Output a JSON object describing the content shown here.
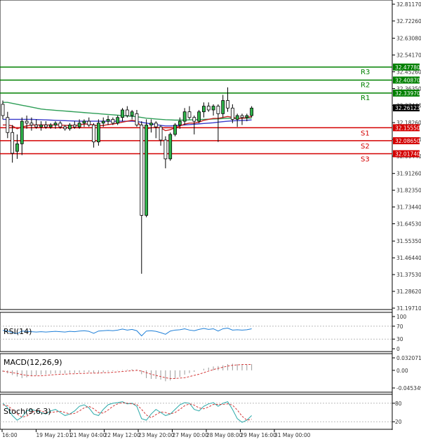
{
  "chart_data": [
    {
      "type": "candlestick",
      "title": "",
      "x_tick_labels": [
        "16:00",
        "19 May 21:01",
        "21 May 04:00",
        "22 May 12:00",
        "23 May 20:00",
        "27 May 00:00",
        "28 May 08:00",
        "29 May 16:00",
        "31 May 00:00"
      ],
      "y_tick_labels": [
        "32.81170",
        "32.72260",
        "32.63080",
        "32.54170",
        "32.45260",
        "32.36350",
        "32.27440",
        "32.18260",
        "32.09350",
        "32.00440",
        "31.91260",
        "31.82350",
        "31.73440",
        "31.64530",
        "31.55350",
        "31.46440",
        "31.37530",
        "31.28620",
        "31.19710"
      ],
      "ylim": [
        31.1971,
        32.8117
      ],
      "current_price": "32.26123",
      "levels": [
        {
          "name": "R3",
          "value": "32.47780",
          "color": "#008000"
        },
        {
          "name": "R2",
          "value": "32.40870",
          "color": "#008000"
        },
        {
          "name": "R1",
          "value": "32.33970",
          "color": "#008000"
        },
        {
          "name": "S1",
          "value": "32.15550",
          "color": "#d40000"
        },
        {
          "name": "S2",
          "value": "32.08650",
          "color": "#d40000"
        },
        {
          "name": "S3",
          "value": "32.01740",
          "color": "#d40000"
        }
      ],
      "candles": [
        {
          "o": 32.28,
          "h": 32.3,
          "l": 32.2,
          "c": 32.22
        },
        {
          "o": 32.21,
          "h": 32.24,
          "l": 32.1,
          "c": 32.13
        },
        {
          "o": 32.13,
          "h": 32.17,
          "l": 31.97,
          "c": 32.02
        },
        {
          "o": 32.03,
          "h": 32.12,
          "l": 31.99,
          "c": 32.07
        },
        {
          "o": 32.07,
          "h": 32.21,
          "l": 32.01,
          "c": 32.19
        },
        {
          "o": 32.19,
          "h": 32.22,
          "l": 32.15,
          "c": 32.18
        },
        {
          "o": 32.18,
          "h": 32.21,
          "l": 32.14,
          "c": 32.17
        },
        {
          "o": 32.17,
          "h": 32.2,
          "l": 32.15,
          "c": 32.16
        },
        {
          "o": 32.16,
          "h": 32.19,
          "l": 32.14,
          "c": 32.17
        },
        {
          "o": 32.17,
          "h": 32.19,
          "l": 32.15,
          "c": 32.16
        },
        {
          "o": 32.16,
          "h": 32.18,
          "l": 32.15,
          "c": 32.17
        },
        {
          "o": 32.17,
          "h": 32.19,
          "l": 32.15,
          "c": 32.18
        },
        {
          "o": 32.18,
          "h": 32.19,
          "l": 32.15,
          "c": 32.16
        },
        {
          "o": 32.16,
          "h": 32.17,
          "l": 32.14,
          "c": 32.15
        },
        {
          "o": 32.15,
          "h": 32.18,
          "l": 32.14,
          "c": 32.17
        },
        {
          "o": 32.17,
          "h": 32.19,
          "l": 32.15,
          "c": 32.16
        },
        {
          "o": 32.16,
          "h": 32.2,
          "l": 32.15,
          "c": 32.18
        },
        {
          "o": 32.18,
          "h": 32.2,
          "l": 32.16,
          "c": 32.19
        },
        {
          "o": 32.19,
          "h": 32.21,
          "l": 32.16,
          "c": 32.17
        },
        {
          "o": 32.17,
          "h": 32.18,
          "l": 32.05,
          "c": 32.08
        },
        {
          "o": 32.08,
          "h": 32.2,
          "l": 32.06,
          "c": 32.18
        },
        {
          "o": 32.18,
          "h": 32.21,
          "l": 32.16,
          "c": 32.19
        },
        {
          "o": 32.19,
          "h": 32.22,
          "l": 32.17,
          "c": 32.2
        },
        {
          "o": 32.2,
          "h": 32.21,
          "l": 32.17,
          "c": 32.18
        },
        {
          "o": 32.18,
          "h": 32.22,
          "l": 32.17,
          "c": 32.21
        },
        {
          "o": 32.21,
          "h": 32.26,
          "l": 32.19,
          "c": 32.25
        },
        {
          "o": 32.25,
          "h": 32.27,
          "l": 32.21,
          "c": 32.22
        },
        {
          "o": 32.22,
          "h": 32.25,
          "l": 32.2,
          "c": 32.24
        },
        {
          "o": 32.23,
          "h": 32.25,
          "l": 32.16,
          "c": 32.17
        },
        {
          "o": 32.17,
          "h": 32.19,
          "l": 31.38,
          "c": 31.69
        },
        {
          "o": 31.69,
          "h": 32.2,
          "l": 31.68,
          "c": 32.17
        },
        {
          "o": 32.17,
          "h": 32.2,
          "l": 32.13,
          "c": 32.18
        },
        {
          "o": 32.18,
          "h": 32.19,
          "l": 32.1,
          "c": 32.16
        },
        {
          "o": 32.16,
          "h": 32.17,
          "l": 32.06,
          "c": 32.09
        },
        {
          "o": 32.09,
          "h": 32.11,
          "l": 31.94,
          "c": 31.99
        },
        {
          "o": 31.99,
          "h": 32.13,
          "l": 31.98,
          "c": 32.12
        },
        {
          "o": 32.12,
          "h": 32.18,
          "l": 32.11,
          "c": 32.17
        },
        {
          "o": 32.17,
          "h": 32.21,
          "l": 32.15,
          "c": 32.19
        },
        {
          "o": 32.19,
          "h": 32.26,
          "l": 32.17,
          "c": 32.24
        },
        {
          "o": 32.24,
          "h": 32.27,
          "l": 32.2,
          "c": 32.21
        },
        {
          "o": 32.21,
          "h": 32.22,
          "l": 32.12,
          "c": 32.19
        },
        {
          "o": 32.19,
          "h": 32.25,
          "l": 32.18,
          "c": 32.24
        },
        {
          "o": 32.24,
          "h": 32.29,
          "l": 32.21,
          "c": 32.27
        },
        {
          "o": 32.27,
          "h": 32.29,
          "l": 32.24,
          "c": 32.25
        },
        {
          "o": 32.25,
          "h": 32.28,
          "l": 32.22,
          "c": 32.27
        },
        {
          "o": 32.27,
          "h": 32.28,
          "l": 32.08,
          "c": 32.23
        },
        {
          "o": 32.23,
          "h": 32.33,
          "l": 32.21,
          "c": 32.3
        },
        {
          "o": 32.3,
          "h": 32.37,
          "l": 32.24,
          "c": 32.26
        },
        {
          "o": 32.26,
          "h": 32.28,
          "l": 32.18,
          "c": 32.2
        },
        {
          "o": 32.2,
          "h": 32.23,
          "l": 32.16,
          "c": 32.22
        },
        {
          "o": 32.22,
          "h": 32.23,
          "l": 32.17,
          "c": 32.21
        },
        {
          "o": 32.21,
          "h": 32.23,
          "l": 32.19,
          "c": 32.22
        },
        {
          "o": 32.22,
          "h": 32.27,
          "l": 32.21,
          "c": 32.26
        }
      ],
      "moving_averages": [
        {
          "color": "#2e9e57",
          "values": [
            32.29,
            32.29,
            32.285,
            32.28,
            32.275,
            32.27,
            32.265,
            32.26,
            32.255,
            32.252,
            32.25,
            32.248,
            32.246,
            32.244,
            32.242,
            32.24,
            32.238,
            32.236,
            32.234,
            32.232,
            32.23,
            32.228,
            32.226,
            32.224,
            32.222,
            32.22,
            32.218,
            32.216,
            32.214,
            32.21,
            32.206,
            32.204,
            32.202,
            32.2,
            32.198,
            32.197,
            32.196,
            32.196,
            32.196,
            32.197,
            32.198,
            32.199,
            32.2,
            32.201,
            32.202,
            32.203,
            32.204,
            32.205,
            32.205,
            32.205,
            32.206,
            32.206,
            32.207
          ]
        },
        {
          "color": "#3a3acb",
          "values": [
            32.2,
            32.2,
            32.2,
            32.2,
            32.2,
            32.2,
            32.2,
            32.199,
            32.198,
            32.197,
            32.196,
            32.195,
            32.194,
            32.193,
            32.192,
            32.191,
            32.19,
            32.19,
            32.19,
            32.19,
            32.19,
            32.19,
            32.19,
            32.19,
            32.19,
            32.19,
            32.19,
            32.19,
            32.189,
            32.184,
            32.18,
            32.176,
            32.172,
            32.168,
            32.165,
            32.165,
            32.166,
            32.168,
            32.17,
            32.172,
            32.174,
            32.176,
            32.178,
            32.18,
            32.182,
            32.185,
            32.188,
            32.19,
            32.192,
            32.193,
            32.194,
            32.195,
            32.197
          ]
        },
        {
          "color": "#c81e1e",
          "values": [
            32.17,
            32.17,
            32.165,
            32.15,
            32.16,
            32.165,
            32.17,
            32.17,
            32.17,
            32.17,
            32.17,
            32.17,
            32.17,
            32.168,
            32.168,
            32.168,
            32.17,
            32.175,
            32.175,
            32.17,
            32.165,
            32.168,
            32.172,
            32.175,
            32.18,
            32.185,
            32.19,
            32.195,
            32.19,
            32.16,
            32.15,
            32.155,
            32.158,
            32.155,
            32.14,
            32.145,
            32.155,
            32.165,
            32.175,
            32.18,
            32.18,
            32.185,
            32.195,
            32.2,
            32.205,
            32.205,
            32.21,
            32.215,
            32.21,
            32.205,
            32.205,
            32.21,
            32.215
          ]
        }
      ]
    },
    {
      "type": "line",
      "title": "RSI(14)",
      "y_tick_labels": [
        "100",
        "70",
        "30",
        "0"
      ],
      "ylim": [
        0,
        100
      ],
      "series": [
        {
          "color": "#1e7fd8",
          "values": [
            57,
            55,
            50,
            47,
            55,
            54,
            53,
            52,
            53,
            52,
            53,
            54,
            53,
            52,
            54,
            53,
            55,
            56,
            54,
            48,
            55,
            56,
            57,
            56,
            58,
            61,
            58,
            60,
            56,
            40,
            55,
            56,
            54,
            50,
            45,
            55,
            58,
            59,
            62,
            58,
            56,
            60,
            63,
            60,
            62,
            55,
            62,
            64,
            58,
            59,
            58,
            59,
            62
          ]
        }
      ]
    },
    {
      "type": "bar+line",
      "title": "MACD(12,26,9)",
      "y_tick_labels": [
        "0.032071",
        "0.00",
        "-0.045349"
      ],
      "ylim": [
        -0.045349,
        0.032071
      ],
      "histogram": [
        -0.004,
        -0.008,
        -0.012,
        -0.016,
        -0.02,
        -0.018,
        -0.015,
        -0.013,
        -0.011,
        -0.01,
        -0.009,
        -0.008,
        -0.008,
        -0.008,
        -0.007,
        -0.007,
        -0.006,
        -0.005,
        -0.005,
        -0.007,
        -0.006,
        -0.005,
        -0.003,
        -0.002,
        -0.001,
        0.001,
        0.002,
        0.003,
        0.002,
        -0.01,
        -0.02,
        -0.022,
        -0.022,
        -0.024,
        -0.028,
        -0.026,
        -0.022,
        -0.017,
        -0.011,
        -0.007,
        -0.004,
        0.0,
        0.004,
        0.007,
        0.01,
        0.011,
        0.013,
        0.016,
        0.017,
        0.016,
        0.015,
        0.015,
        0.016
      ],
      "signal": [
        -0.002,
        -0.004,
        -0.006,
        -0.008,
        -0.011,
        -0.013,
        -0.014,
        -0.014,
        -0.014,
        -0.013,
        -0.012,
        -0.011,
        -0.01,
        -0.01,
        -0.009,
        -0.009,
        -0.008,
        -0.008,
        -0.007,
        -0.007,
        -0.007,
        -0.006,
        -0.006,
        -0.005,
        -0.004,
        -0.003,
        -0.002,
        -0.001,
        0.0,
        -0.002,
        -0.006,
        -0.01,
        -0.013,
        -0.016,
        -0.019,
        -0.021,
        -0.021,
        -0.02,
        -0.019,
        -0.016,
        -0.013,
        -0.01,
        -0.006,
        -0.002,
        0.002,
        0.005,
        0.008,
        0.011,
        0.013,
        0.014,
        0.015,
        0.015,
        0.015
      ]
    },
    {
      "type": "line",
      "title": "Stoch(9,6,3)",
      "y_tick_labels": [
        "80",
        "20"
      ],
      "ylim": [
        0,
        100
      ],
      "series": [
        {
          "color": "#2aa9a9",
          "values": [
            80,
            65,
            40,
            25,
            35,
            55,
            60,
            55,
            50,
            45,
            55,
            60,
            50,
            40,
            45,
            55,
            70,
            75,
            65,
            45,
            40,
            60,
            75,
            80,
            82,
            85,
            78,
            80,
            70,
            30,
            25,
            45,
            60,
            50,
            40,
            45,
            60,
            75,
            82,
            80,
            60,
            55,
            70,
            78,
            82,
            70,
            80,
            85,
            60,
            30,
            18,
            25,
            40
          ]
        },
        {
          "color": "#d43a3a",
          "values": [
            75,
            72,
            60,
            45,
            35,
            38,
            50,
            57,
            55,
            50,
            50,
            52,
            54,
            50,
            45,
            47,
            55,
            65,
            70,
            62,
            50,
            48,
            58,
            70,
            78,
            82,
            80,
            78,
            76,
            60,
            42,
            33,
            43,
            52,
            50,
            45,
            50,
            60,
            72,
            78,
            74,
            65,
            62,
            68,
            76,
            76,
            76,
            78,
            74,
            58,
            38,
            25,
            28
          ]
        }
      ]
    }
  ]
}
